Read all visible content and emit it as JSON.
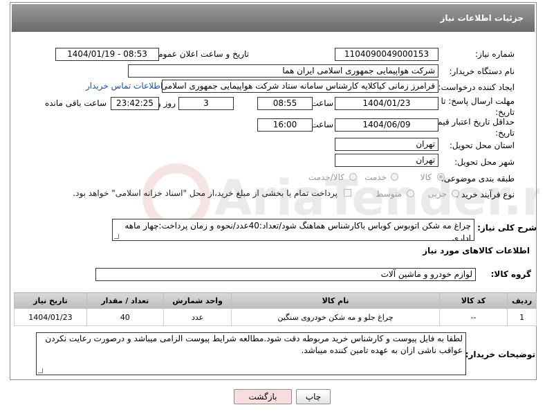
{
  "header": {
    "title": "جزئیات اطلاعات نیاز"
  },
  "labels": {
    "need_number": "شماره نیاز:",
    "announce_datetime": "تاریخ و ساعت اعلان عمومی:",
    "buyer_org": "نام دستگاه خریدار:",
    "requester": "ایجاد کننده درخواست:",
    "deadline": "مهلت ارسال پاسخ: تا تاریخ:",
    "min_price_validity": "حداقل تاریخ اعتبار قیمت: تا تاریخ:",
    "time": "ساعت",
    "day_and": "روز و",
    "remaining": "ساعت باقی مانده",
    "delivery_province": "استان محل تحویل:",
    "delivery_city": "شهر محل تحویل:",
    "category": "طبقه بندی موضوعی:",
    "purchase_type": "نوع فرآیند خرید :",
    "general_desc": "شرح کلی نیاز:",
    "goods_info": "اطلاعات کالاهای مورد نیاز",
    "goods_group": "گروه کالا:",
    "buyer_notes": "توضیحات خریدار:"
  },
  "fields": {
    "need_number": "1104090049000153",
    "announce_datetime": "1404/01/19 - 08:53",
    "buyer_org": "شرکت هواپیمایی جمهوری اسلامی ایران هما",
    "requester": "قرامرز زمانی کیاکلایه کارشناس سامانه ستاد شرکت هواپیمایی جمهوری اسلامی ایران هما",
    "contact_link": "اطلاعات تماس خریدار",
    "deadline_date": "1404/01/23",
    "deadline_time": "08:55",
    "days": "3",
    "remaining_time": "23:42:25",
    "validity_date": "1404/06/09",
    "validity_time": "16:00",
    "province": "تهران",
    "city": "تهران",
    "general_desc": "چراغ مه شکن اتوبوس کوباس باکارشناس هماهنگ شود/تعداد:40عدد/نحوه و زمان پرداخت:چهار ماهه اداری",
    "goods_group": "لوازم خودرو و ماشین آلات",
    "buyer_notes": "لطفا به فایل پیوست و کارشناس خرید مربوطه دقت شود.مطالعه شرایط پیوست الزامی میباشد و درصورت رعایت نکردن عواقب ناشی ازان به عهده تامین کننده میباشد."
  },
  "category_options": [
    "کالا",
    "خدمت",
    "کالا/خدمت"
  ],
  "category_selected": "کالا",
  "purchase_options": [
    "جزیی",
    "متوسط"
  ],
  "purchase_note": "پرداخت تمام یا بخشی از مبلغ خرید،از محل \"اسناد خزانه اسلامی\" خواهد بود.",
  "table": {
    "headers": [
      "ردیف",
      "کد کالا",
      "نام کالا",
      "واحد شمارش",
      "تعداد / مقدار",
      "تاریخ نیاز"
    ],
    "rows": [
      [
        "1",
        "--",
        "چراغ جلو و مه شکن خودروی سنگین",
        "عدد",
        "40",
        "1404/01/23"
      ]
    ]
  },
  "buttons": {
    "print": "چاپ",
    "back": "بازگشت"
  },
  "watermark": "AriaTender.neT",
  "colors": {
    "header_bg": "#7a7a7a",
    "link": "#1a4fb5",
    "back_bg": "#f7dede"
  }
}
